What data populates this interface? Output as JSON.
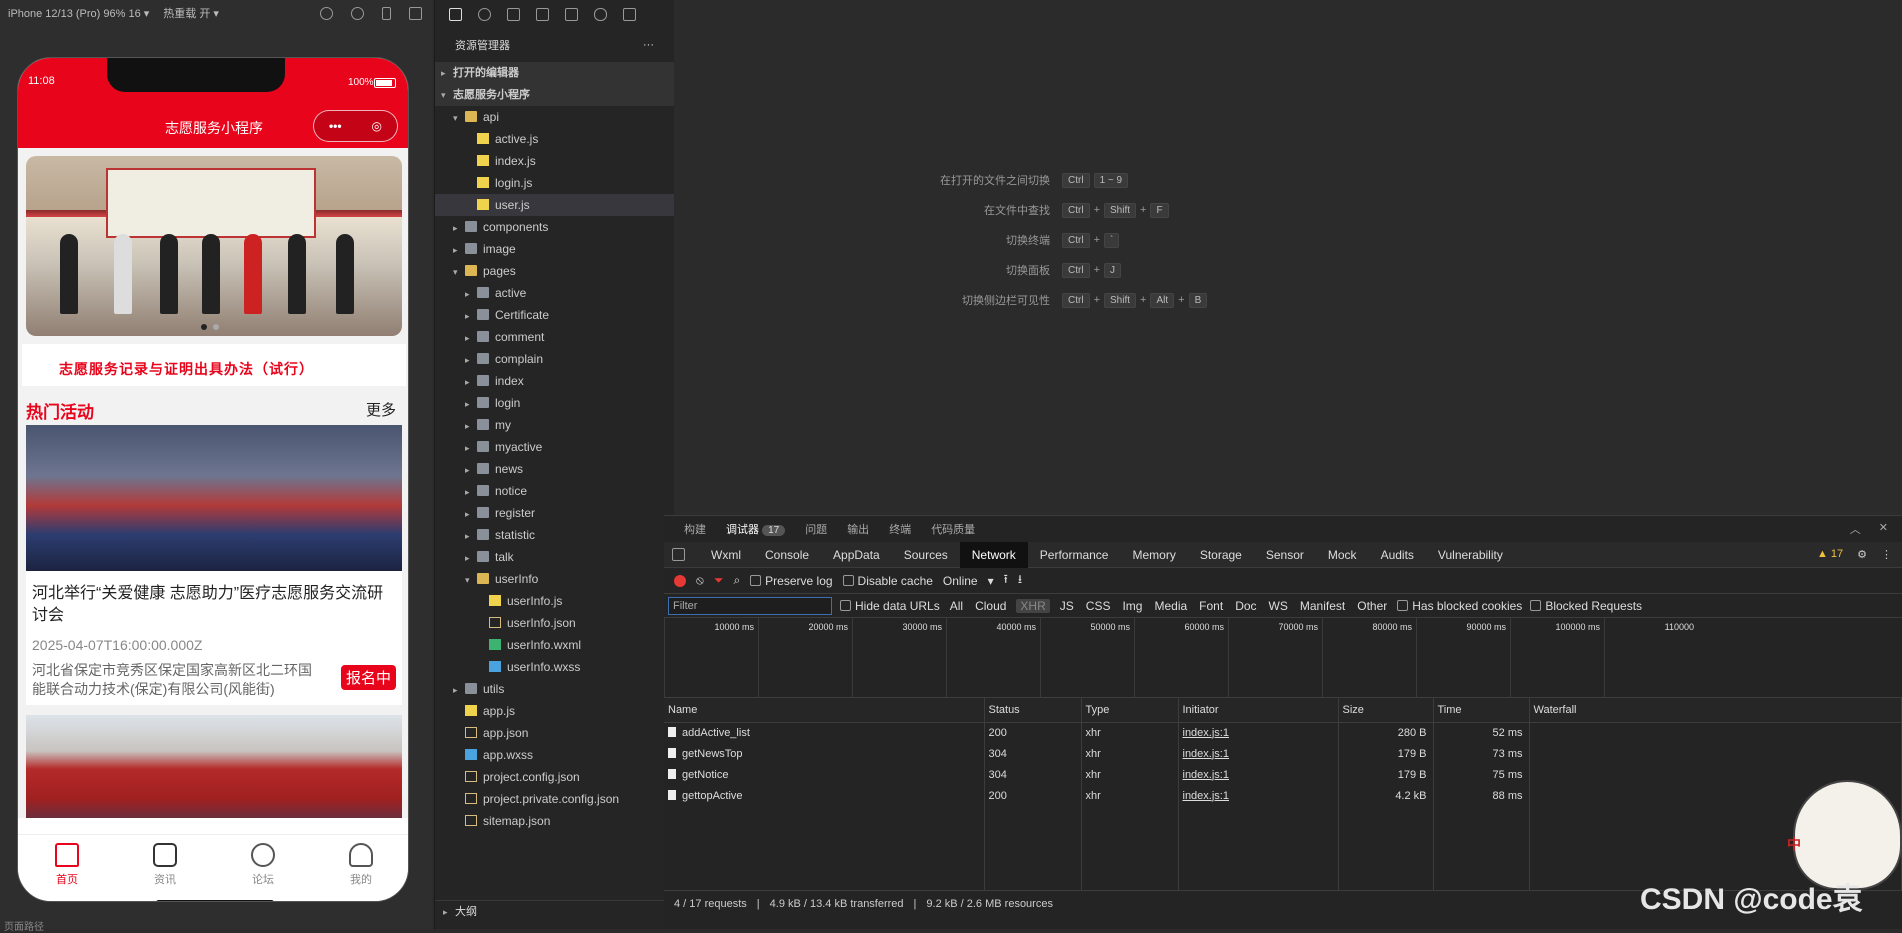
{
  "simulator": {
    "device": "iPhone 12/13 (Pro) 96% 16 ▾",
    "hot_reload": "热重载 开 ▾",
    "footer": "页面路径"
  },
  "phone": {
    "time": "11:08",
    "battery": "100%",
    "title": "志愿服务小程序",
    "capsule_more": "•••",
    "capsule_close": "◎",
    "notice": "志愿服务记录与证明出具办法（试行）",
    "section_title": "热门活动",
    "more": "更多",
    "cards": [
      {
        "title": "河北举行“关爱健康 志愿助力”医疗志愿服务交流研讨会",
        "date": "2025-04-07T16:00:00.000Z",
        "address": "河北省保定市竞秀区保定国家高新区北二环国能联合动力技术(保定)有限公司(风能街)",
        "tag": "报名中"
      }
    ],
    "tabs": [
      {
        "label": "首页",
        "icon": "home-icon"
      },
      {
        "label": "资讯",
        "icon": "news-icon"
      },
      {
        "label": "论坛",
        "icon": "forum-icon"
      },
      {
        "label": "我的",
        "icon": "user-icon"
      }
    ]
  },
  "explorer": {
    "title": "资源管理器",
    "title_menu": "···",
    "open_editors": "打开的编辑器",
    "project": "志愿服务小程序",
    "outline": "大纲",
    "tree": [
      {
        "label": "api",
        "type": "folder-open",
        "level": 1,
        "caret": "▾"
      },
      {
        "label": "active.js",
        "type": "js",
        "level": 2
      },
      {
        "label": "index.js",
        "type": "js",
        "level": 2
      },
      {
        "label": "login.js",
        "type": "js",
        "level": 2
      },
      {
        "label": "user.js",
        "type": "js",
        "level": 2,
        "selected": true
      },
      {
        "label": "components",
        "type": "folder",
        "level": 1,
        "caret": "▸"
      },
      {
        "label": "image",
        "type": "folder",
        "level": 1,
        "caret": "▸"
      },
      {
        "label": "pages",
        "type": "folder-open",
        "level": 1,
        "caret": "▾"
      },
      {
        "label": "active",
        "type": "folder",
        "level": 2,
        "caret": "▸"
      },
      {
        "label": "Certificate",
        "type": "folder",
        "level": 2,
        "caret": "▸"
      },
      {
        "label": "comment",
        "type": "folder",
        "level": 2,
        "caret": "▸"
      },
      {
        "label": "complain",
        "type": "folder",
        "level": 2,
        "caret": "▸"
      },
      {
        "label": "index",
        "type": "folder",
        "level": 2,
        "caret": "▸"
      },
      {
        "label": "login",
        "type": "folder",
        "level": 2,
        "caret": "▸"
      },
      {
        "label": "my",
        "type": "folder",
        "level": 2,
        "caret": "▸"
      },
      {
        "label": "myactive",
        "type": "folder",
        "level": 2,
        "caret": "▸"
      },
      {
        "label": "news",
        "type": "folder",
        "level": 2,
        "caret": "▸"
      },
      {
        "label": "notice",
        "type": "folder",
        "level": 2,
        "caret": "▸"
      },
      {
        "label": "register",
        "type": "folder",
        "level": 2,
        "caret": "▸"
      },
      {
        "label": "statistic",
        "type": "folder",
        "level": 2,
        "caret": "▸"
      },
      {
        "label": "talk",
        "type": "folder",
        "level": 2,
        "caret": "▸"
      },
      {
        "label": "userInfo",
        "type": "folder-open",
        "level": 2,
        "caret": "▾"
      },
      {
        "label": "userInfo.js",
        "type": "js",
        "level": 3
      },
      {
        "label": "userInfo.json",
        "type": "json",
        "level": 3
      },
      {
        "label": "userInfo.wxml",
        "type": "wxml",
        "level": 3
      },
      {
        "label": "userInfo.wxss",
        "type": "wxss",
        "level": 3
      },
      {
        "label": "utils",
        "type": "folder",
        "level": 1,
        "caret": "▸"
      },
      {
        "label": "app.js",
        "type": "js",
        "level": 1
      },
      {
        "label": "app.json",
        "type": "json",
        "level": 1
      },
      {
        "label": "app.wxss",
        "type": "wxss",
        "level": 1
      },
      {
        "label": "project.config.json",
        "type": "json",
        "level": 1
      },
      {
        "label": "project.private.config.json",
        "type": "json",
        "level": 1
      },
      {
        "label": "sitemap.json",
        "type": "json",
        "level": 1
      }
    ]
  },
  "editor": {
    "shortcuts": [
      {
        "label": "在打开的文件之间切换",
        "keys": [
          "Ctrl",
          "1 ~ 9"
        ]
      },
      {
        "label": "在文件中查找",
        "keys": [
          "Ctrl",
          "+",
          "Shift",
          "+",
          "F"
        ]
      },
      {
        "label": "切换终端",
        "keys": [
          "Ctrl",
          "+",
          "`"
        ]
      },
      {
        "label": "切换面板",
        "keys": [
          "Ctrl",
          "+",
          "J"
        ]
      },
      {
        "label": "切换侧边栏可见性",
        "keys": [
          "Ctrl",
          "+",
          "Shift",
          "+",
          "Alt",
          "+",
          "B"
        ]
      }
    ]
  },
  "devtools": {
    "top_tabs": [
      "构建",
      "调试器",
      "问题",
      "输出",
      "终端",
      "代码质量"
    ],
    "debugger_badge": "17",
    "tabs": [
      "Wxml",
      "Console",
      "AppData",
      "Sources",
      "Network",
      "Performance",
      "Memory",
      "Storage",
      "Sensor",
      "Mock",
      "Audits",
      "Vulnerability"
    ],
    "active_tab": "Network",
    "warning_count": "▲ 17",
    "toolbar": {
      "preserve_log": "Preserve log",
      "disable_cache": "Disable cache",
      "throttle": "Online"
    },
    "filter": {
      "placeholder": "Filter",
      "hide_data_urls": "Hide data URLs",
      "types": [
        "All",
        "Cloud",
        "XHR",
        "JS",
        "CSS",
        "Img",
        "Media",
        "Font",
        "Doc",
        "WS",
        "Manifest",
        "Other"
      ],
      "has_blocked_cookies": "Has blocked cookies",
      "blocked_requests": "Blocked Requests"
    },
    "timeline_ticks": [
      "10000 ms",
      "20000 ms",
      "30000 ms",
      "40000 ms",
      "50000 ms",
      "60000 ms",
      "70000 ms",
      "80000 ms",
      "90000 ms",
      "100000 ms",
      "110000"
    ],
    "columns": [
      "Name",
      "Status",
      "Type",
      "Initiator",
      "Size",
      "Time",
      "Waterfall"
    ],
    "rows": [
      {
        "name": "addActive_list",
        "status": "200",
        "type": "xhr",
        "initiator": "index.js:1",
        "size": "280 B",
        "time": "52 ms"
      },
      {
        "name": "getNewsTop",
        "status": "304",
        "type": "xhr",
        "initiator": "index.js:1",
        "size": "179 B",
        "time": "73 ms"
      },
      {
        "name": "getNotice",
        "status": "304",
        "type": "xhr",
        "initiator": "index.js:1",
        "size": "179 B",
        "time": "75 ms"
      },
      {
        "name": "gettopActive",
        "status": "200",
        "type": "xhr",
        "initiator": "index.js:1",
        "size": "4.2 kB",
        "time": "88 ms"
      }
    ],
    "status": {
      "requests": "4 / 17 requests",
      "transferred": "4.9 kB / 13.4 kB transferred",
      "resources": "9.2 kB / 2.6 MB resources"
    }
  },
  "watermark": "CSDN @code袁",
  "mascot_badge": "中"
}
